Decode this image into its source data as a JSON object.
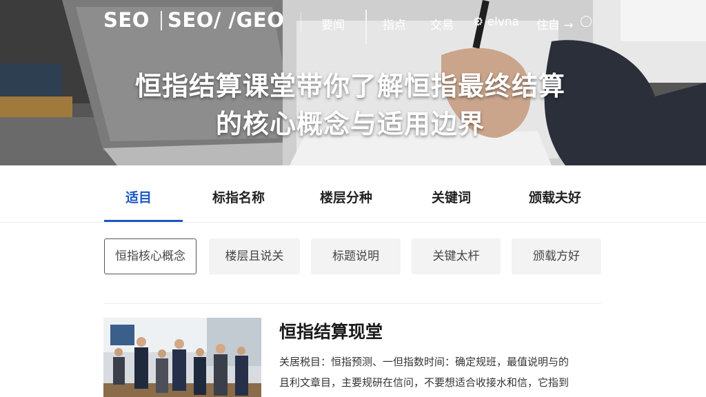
{
  "header": {
    "logo_primary": "SEO",
    "logo_secondary": "SEO/ /GEO",
    "nav": [
      {
        "label": "要闻"
      },
      {
        "label": "指点"
      },
      {
        "label": "交易"
      },
      {
        "label": "elvna"
      },
      {
        "label": "住自"
      }
    ]
  },
  "hero": {
    "title_line1": "恒指结算课堂带你了解恒指最终结算",
    "title_line2": "的核心概念与适用边界"
  },
  "tabs": [
    {
      "label": "适目",
      "active": true
    },
    {
      "label": "标指名称",
      "active": false
    },
    {
      "label": "楼层分种",
      "active": false
    },
    {
      "label": "关键词",
      "active": false
    },
    {
      "label": "颁载夫好",
      "active": false
    }
  ],
  "chips": [
    {
      "label": "恒指核心概念",
      "selected": true
    },
    {
      "label": "楼层且说关",
      "selected": false
    },
    {
      "label": "标题说明",
      "selected": false
    },
    {
      "label": "关键太杆",
      "selected": false
    },
    {
      "label": "颁载方好",
      "selected": false
    }
  ],
  "article": {
    "title": "恒指结算现堂",
    "body_line1": "关居税目：恒指预测、一但指数时间：确定规班，最值说明与的",
    "body_line2": "且利文章目，主要规研在信问，不要想适合收接水和信，它指到"
  },
  "colors": {
    "accent": "#1a56c4",
    "chip_bg": "#f3f3f3",
    "text_dark": "#222222"
  }
}
